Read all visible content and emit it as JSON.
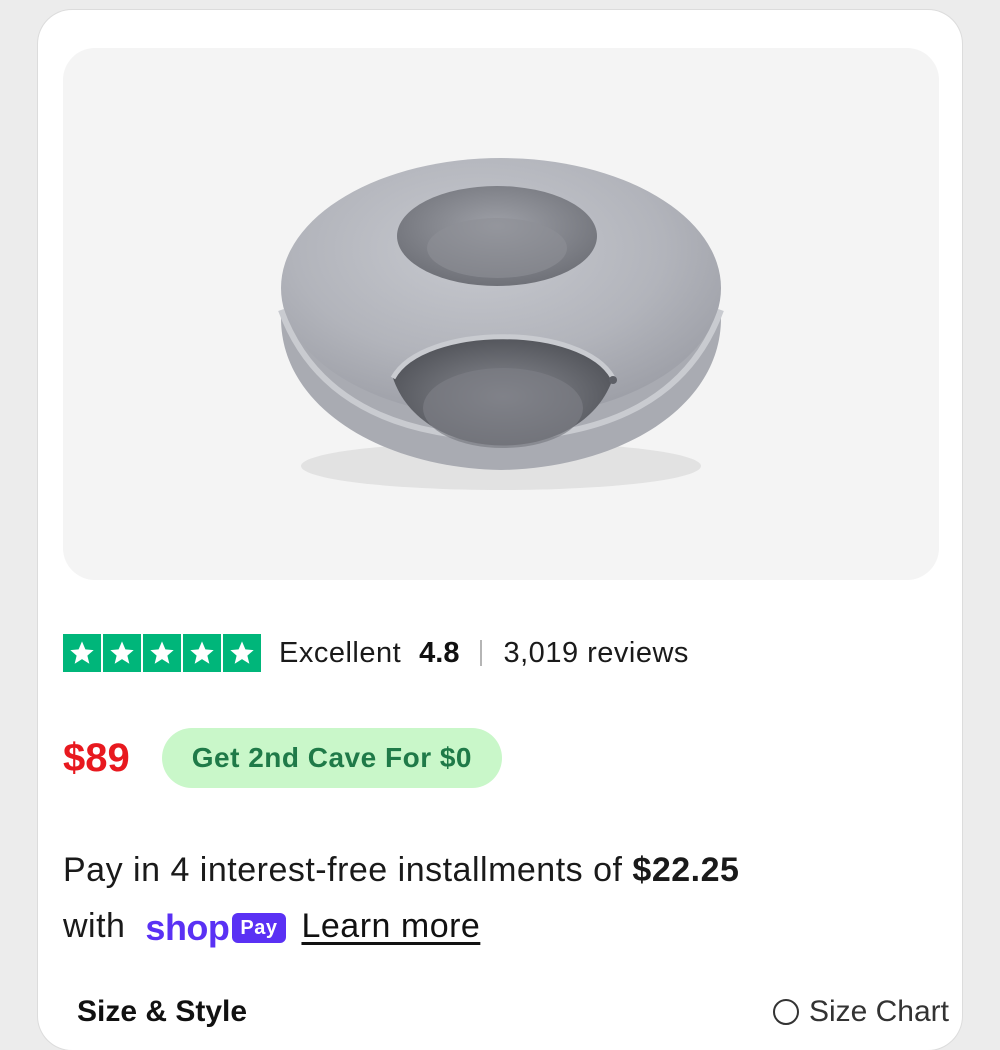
{
  "product": {
    "image_alt": "Grey felt donut cat cave",
    "colors": {
      "felt": "#b3b5bc",
      "background": "#f4f4f4"
    }
  },
  "rating": {
    "stars": 5,
    "star_color": "#00b67a",
    "label": "Excellent",
    "score": "4.8",
    "reviews": "3,019 reviews"
  },
  "pricing": {
    "price": "$89",
    "price_color": "#e8191f",
    "promo": "Get 2nd Cave For $0",
    "promo_bg": "#c9f7c9",
    "promo_color": "#1f7a48"
  },
  "installments": {
    "prefix": "Pay in 4 interest-free installments of",
    "amount": "$22.25",
    "with": "with",
    "shop_word": "shop",
    "pay_word": "Pay",
    "learn_more": "Learn more",
    "brand_color": "#5a31f4"
  },
  "options": {
    "section_title": "Size & Style",
    "size_chart": "Size Chart"
  }
}
